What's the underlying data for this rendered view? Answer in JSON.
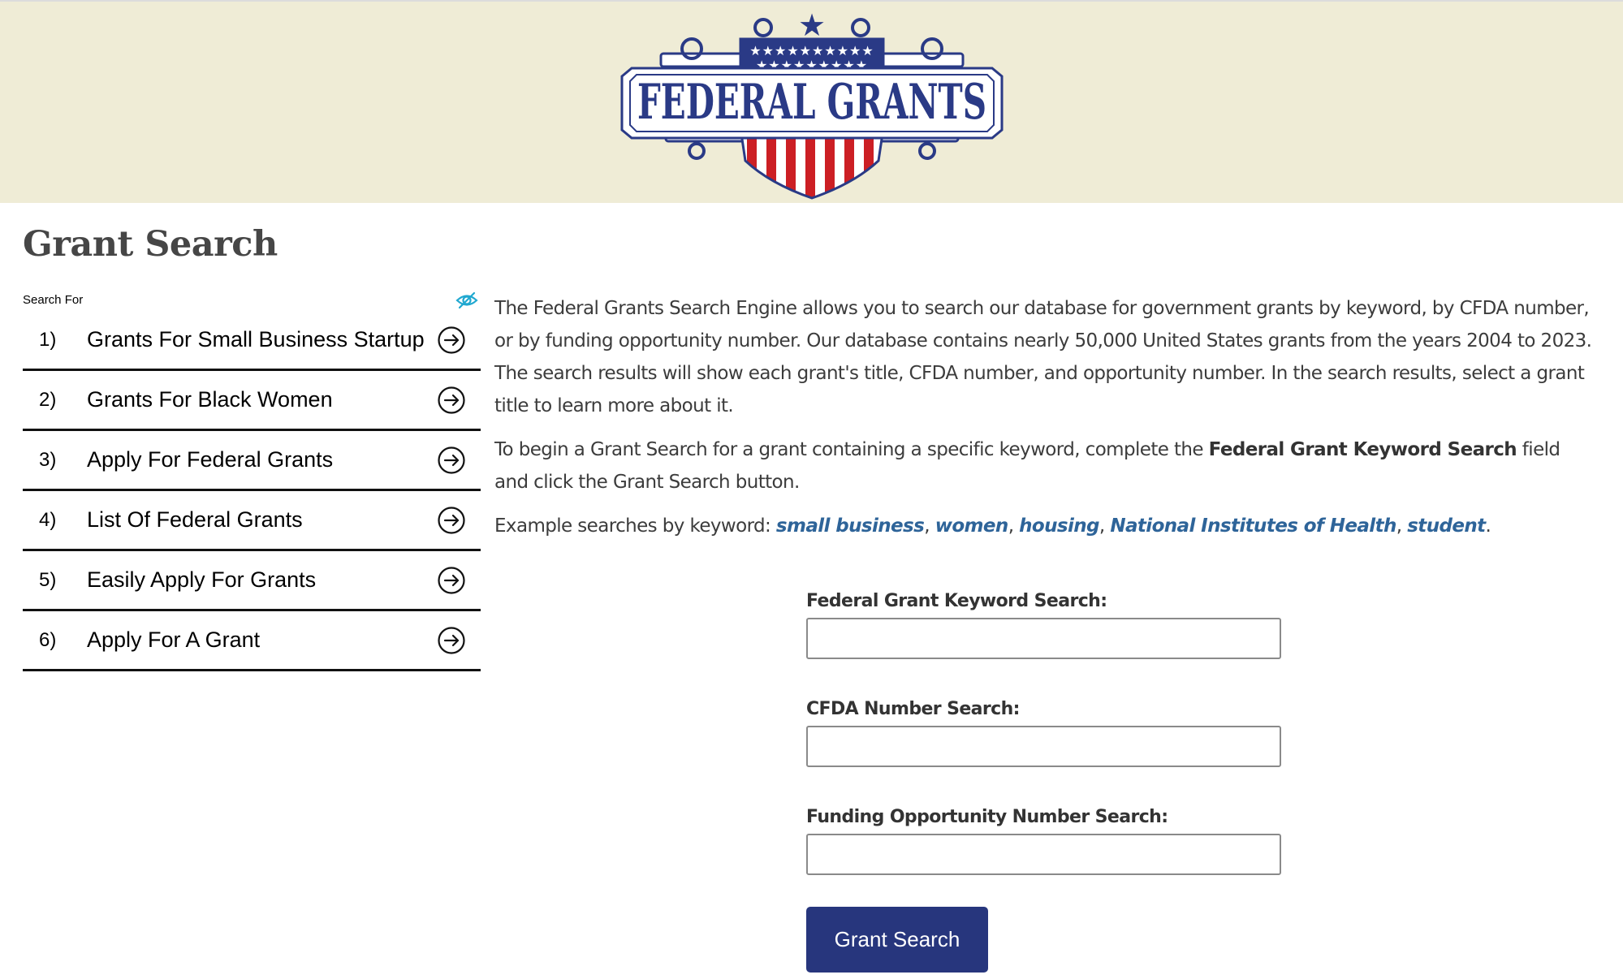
{
  "header": {
    "logo_text": "FEDERAL GRANTS",
    "logo_icon": "federal-grants-shield-logo"
  },
  "page": {
    "title": "Grant Search"
  },
  "sidebar": {
    "label": "Search For",
    "toggle_icon": "eye-slash-icon",
    "items": [
      {
        "number": "1)",
        "label": "Grants For Small Business Startup",
        "icon": "arrow-right-circle-icon"
      },
      {
        "number": "2)",
        "label": "Grants For Black Women",
        "icon": "arrow-right-circle-icon"
      },
      {
        "number": "3)",
        "label": "Apply For Federal Grants",
        "icon": "arrow-right-circle-icon"
      },
      {
        "number": "4)",
        "label": "List Of Federal Grants",
        "icon": "arrow-right-circle-icon"
      },
      {
        "number": "5)",
        "label": "Easily Apply For Grants",
        "icon": "arrow-right-circle-icon"
      },
      {
        "number": "6)",
        "label": "Apply For A Grant",
        "icon": "arrow-right-circle-icon"
      }
    ]
  },
  "intro": {
    "paragraph1": "The Federal Grants Search Engine allows you to search our database for government grants by keyword, by CFDA number, or by funding opportunity number. Our database contains nearly 50,000 United States grants from the years 2004 to 2023. The search results will show each grant's title, CFDA number, and opportunity number. In the search results, select a grant title to learn more about it.",
    "paragraph2_before": "To begin a Grant Search for a grant containing a specific keyword, complete the ",
    "paragraph2_bold": "Federal Grant Keyword Search",
    "paragraph2_after": " field and click the Grant Search button.",
    "examples_prefix": "Example searches by keyword: ",
    "examples": [
      "small business",
      "women",
      "housing",
      "National Institutes of Health",
      "student"
    ],
    "separator": ", ",
    "examples_suffix": "."
  },
  "form": {
    "keyword_label": "Federal Grant Keyword Search:",
    "keyword_value": "",
    "cfda_label": "CFDA Number Search:",
    "cfda_value": "",
    "fon_label": "Funding Opportunity Number Search:",
    "fon_value": "",
    "submit_label": "Grant Search"
  },
  "colors": {
    "header_bg": "#efecd6",
    "brand_navy": "#27367d",
    "link_blue": "#2e6499",
    "logo_red": "#cc1f24",
    "accent_cyan": "#20a8d0"
  }
}
